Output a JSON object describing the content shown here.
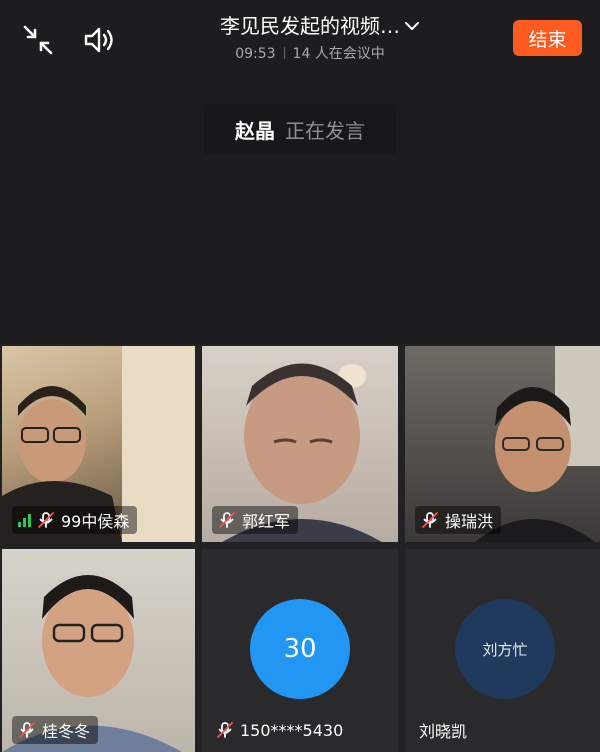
{
  "header": {
    "title": "李见民发起的视频…",
    "time": "09:53",
    "participants": "14 人在会议中",
    "end_label": "结束",
    "accent_color": "#ff5a1f"
  },
  "speaker": {
    "name": "赵晶",
    "status": "正在发言"
  },
  "tiles": [
    {
      "name": "99中侯森",
      "mic": "muted",
      "signal": true,
      "video": true
    },
    {
      "name": "郭红军",
      "mic": "muted",
      "video": true
    },
    {
      "name": "操瑞洪",
      "mic": "muted",
      "video": true
    },
    {
      "name": "桂冬冬",
      "mic": "muted",
      "video": true
    },
    {
      "name": "150****5430",
      "mic": "muted",
      "video": false,
      "avatar_text": "30",
      "avatar_color": "#2196f3"
    },
    {
      "name": "刘晓凯",
      "mic": "none",
      "video": false,
      "avatar_text": "刘方忙",
      "avatar_color": "#1f3a5c"
    }
  ]
}
